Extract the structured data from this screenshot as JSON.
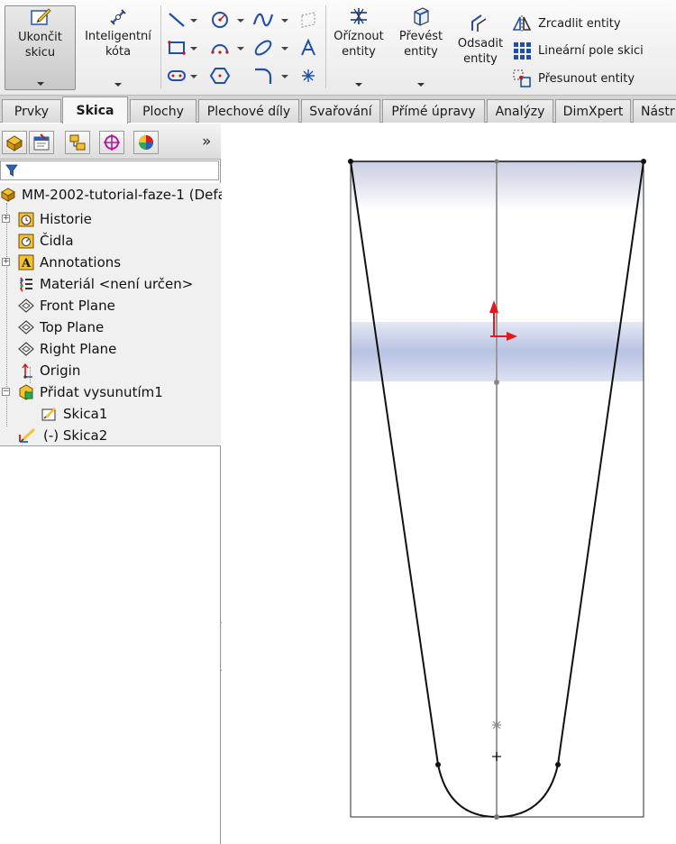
{
  "ribbon": {
    "exit_sketch": "Ukončit\nskicu",
    "smart_dimension": "Inteligentní\nkóta",
    "trim_entities": "Oříznout\nentity",
    "convert_entities": "Převést\nentity",
    "offset_entities": "Odsadit\nentity",
    "mirror_entities": "Zrcadlit entity",
    "linear_pattern": "Lineární pole skici",
    "move_entities": "Přesunout entity"
  },
  "tabs": [
    "Prvky",
    "Skica",
    "Plochy",
    "Plechové díly",
    "Svařování",
    "Přímé úpravy",
    "Analýzy",
    "DimXpert",
    "Nástr"
  ],
  "active_tab": "Skica",
  "tree": {
    "root": "MM-2002-tutorial-faze-1  (Defa",
    "items": [
      "Historie",
      "Čidla",
      "Annotations",
      "Materiál <není určen>",
      "Front Plane",
      "Top Plane",
      "Right Plane",
      "Origin",
      "Přidat vysunutím1",
      "Skica1",
      "(-) Skica2"
    ]
  },
  "panel": {
    "more_symbol": "»"
  },
  "colors": {
    "accent_red": "#e0191c",
    "selection_blue": "#b8c2e3",
    "sketch_black": "#111111"
  }
}
